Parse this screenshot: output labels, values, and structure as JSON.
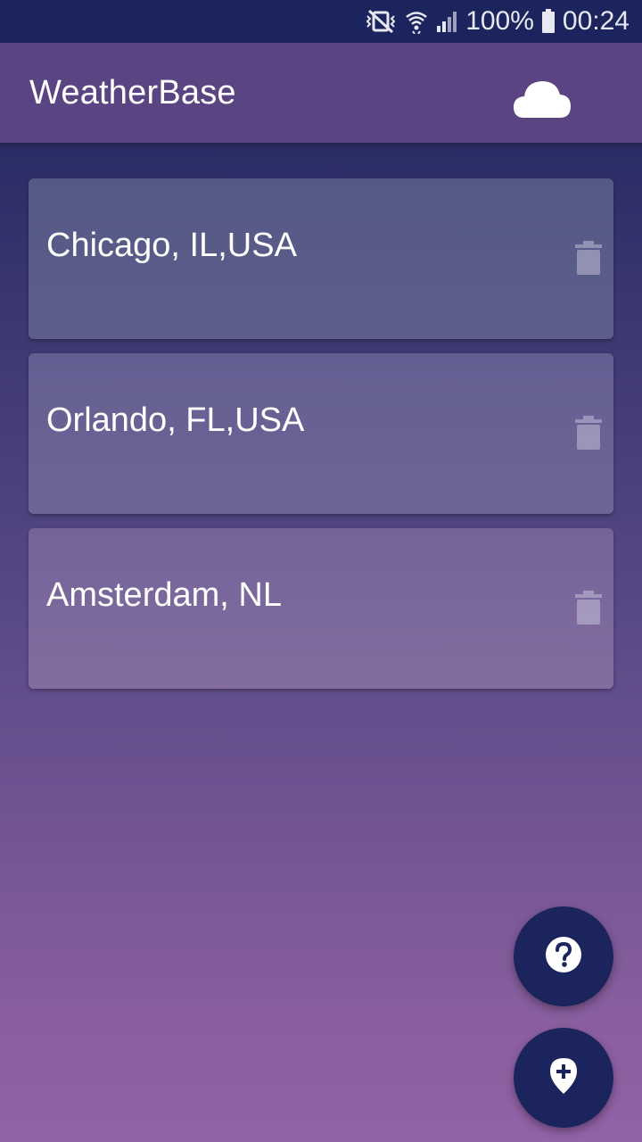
{
  "status_bar": {
    "battery_percent": "100%",
    "time": "00:24",
    "icons": [
      "vibrate-mute-icon",
      "wifi-icon",
      "signal-icon",
      "battery-icon"
    ]
  },
  "app_bar": {
    "title": "WeatherBase",
    "action_icon": "cloud-icon"
  },
  "cities": [
    {
      "name": "Chicago, IL,USA",
      "action_icon": "trash-icon"
    },
    {
      "name": "Orlando, FL,USA",
      "action_icon": "trash-icon"
    },
    {
      "name": "Amsterdam, NL",
      "action_icon": "trash-icon"
    }
  ],
  "fabs": [
    {
      "icon": "help-icon"
    },
    {
      "icon": "add-location-icon"
    }
  ],
  "colors": {
    "status_bar": "#1b245c",
    "app_bar": "#5a4481",
    "fab": "#1b245c",
    "text": "#ffffff"
  }
}
